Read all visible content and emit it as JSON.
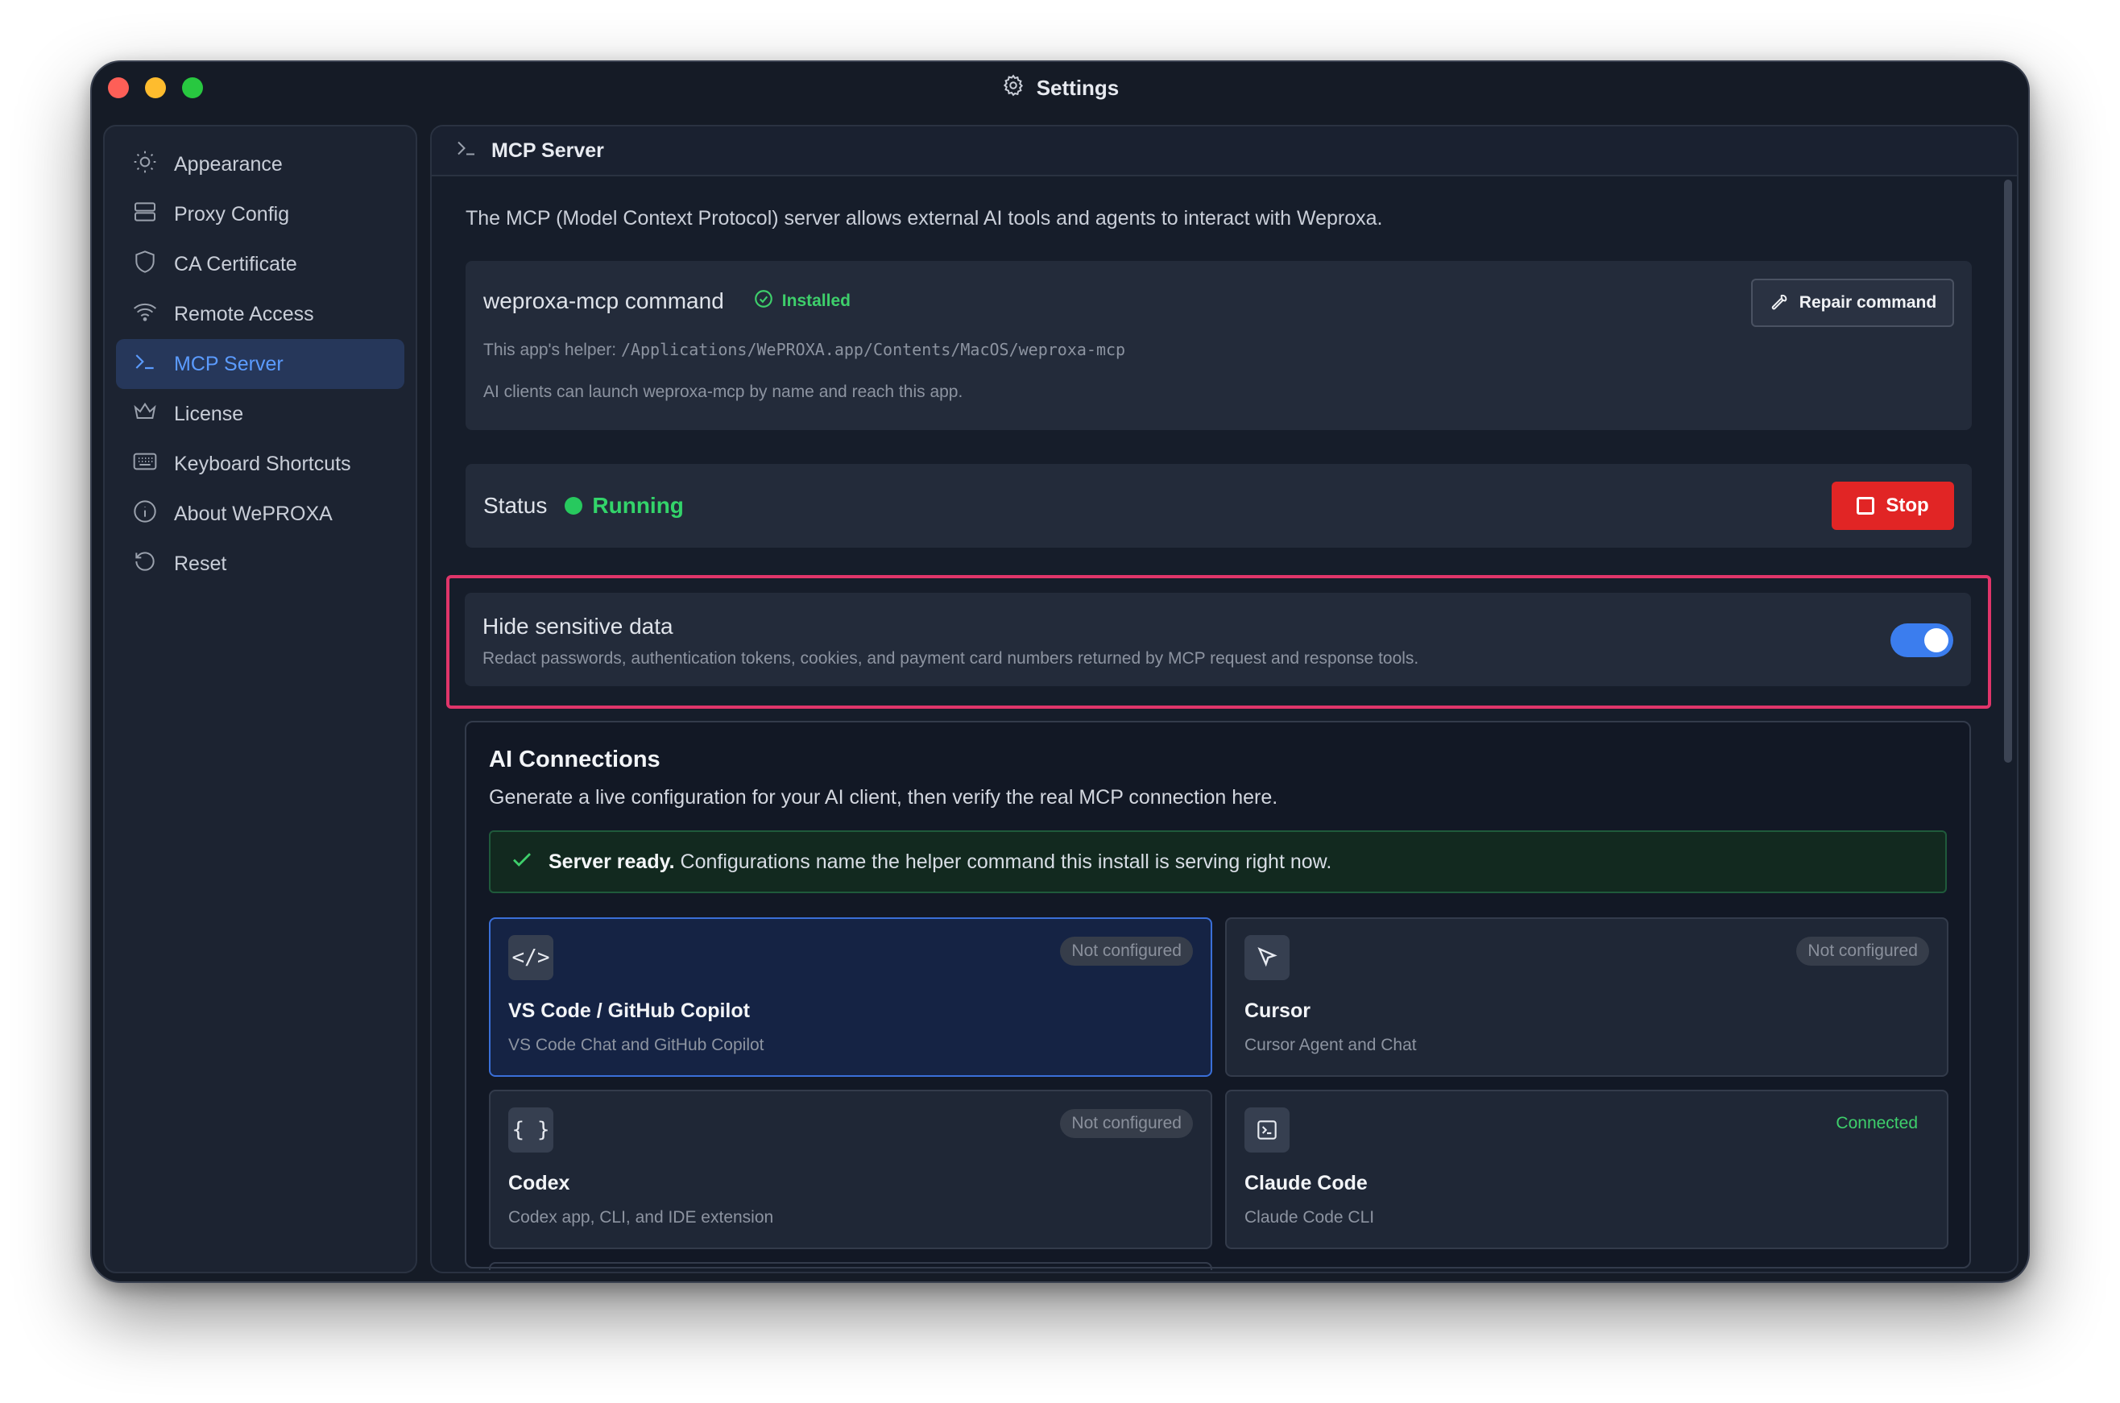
{
  "window": {
    "title": "Settings"
  },
  "sidebar": {
    "items": [
      {
        "label": "Appearance",
        "icon": "sun-icon"
      },
      {
        "label": "Proxy Config",
        "icon": "server-icon"
      },
      {
        "label": "CA Certificate",
        "icon": "shield-icon"
      },
      {
        "label": "Remote Access",
        "icon": "wifi-icon"
      },
      {
        "label": "MCP Server",
        "icon": "terminal-icon",
        "active": true
      },
      {
        "label": "License",
        "icon": "crown-icon"
      },
      {
        "label": "Keyboard Shortcuts",
        "icon": "keyboard-icon"
      },
      {
        "label": "About WePROXA",
        "icon": "info-icon"
      },
      {
        "label": "Reset",
        "icon": "reset-icon"
      }
    ]
  },
  "panel": {
    "header": "MCP Server",
    "intro": "The MCP (Model Context Protocol) server allows external AI tools and agents to interact with Weproxa.",
    "command": {
      "title": "weproxa-mcp command",
      "status": "Installed",
      "repair_label": "Repair command",
      "helper_prefix": "This app's helper: ",
      "helper_path": "/Applications/WePROXA.app/Contents/MacOS/weproxa-mcp",
      "launch_note": "AI clients can launch weproxa-mcp by name and reach this app."
    },
    "status": {
      "label": "Status",
      "value": "Running",
      "stop_label": "Stop"
    },
    "hide_sensitive": {
      "title": "Hide sensitive data",
      "description": "Redact passwords, authentication tokens, cookies, and payment card numbers returned by MCP request and response tools.",
      "enabled": true
    },
    "ai": {
      "title": "AI Connections",
      "subtitle": "Generate a live configuration for your AI client, then verify the real MCP connection here.",
      "ready_bold": "Server ready.",
      "ready_text": " Configurations name the helper command this install is serving right now.",
      "clients": [
        {
          "name": "VS Code / GitHub Copilot",
          "desc": "VS Code Chat and GitHub Copilot",
          "status": "Not configured",
          "icon": "code-icon",
          "glyph": "</>"
        },
        {
          "name": "Cursor",
          "desc": "Cursor Agent and Chat",
          "status": "Not configured",
          "icon": "cursor-arrow-icon",
          "glyph": ""
        },
        {
          "name": "Codex",
          "desc": "Codex app, CLI, and IDE extension",
          "status": "Not configured",
          "icon": "braces-icon",
          "glyph": "{ }"
        },
        {
          "name": "Claude Code",
          "desc": "Claude Code CLI",
          "status": "Connected",
          "icon": "terminal-box-icon",
          "glyph": ""
        }
      ]
    }
  },
  "colors": {
    "accent": "#3b7dee",
    "running": "#33d46a",
    "stop": "#e12525",
    "highlight": "#e0356a"
  }
}
